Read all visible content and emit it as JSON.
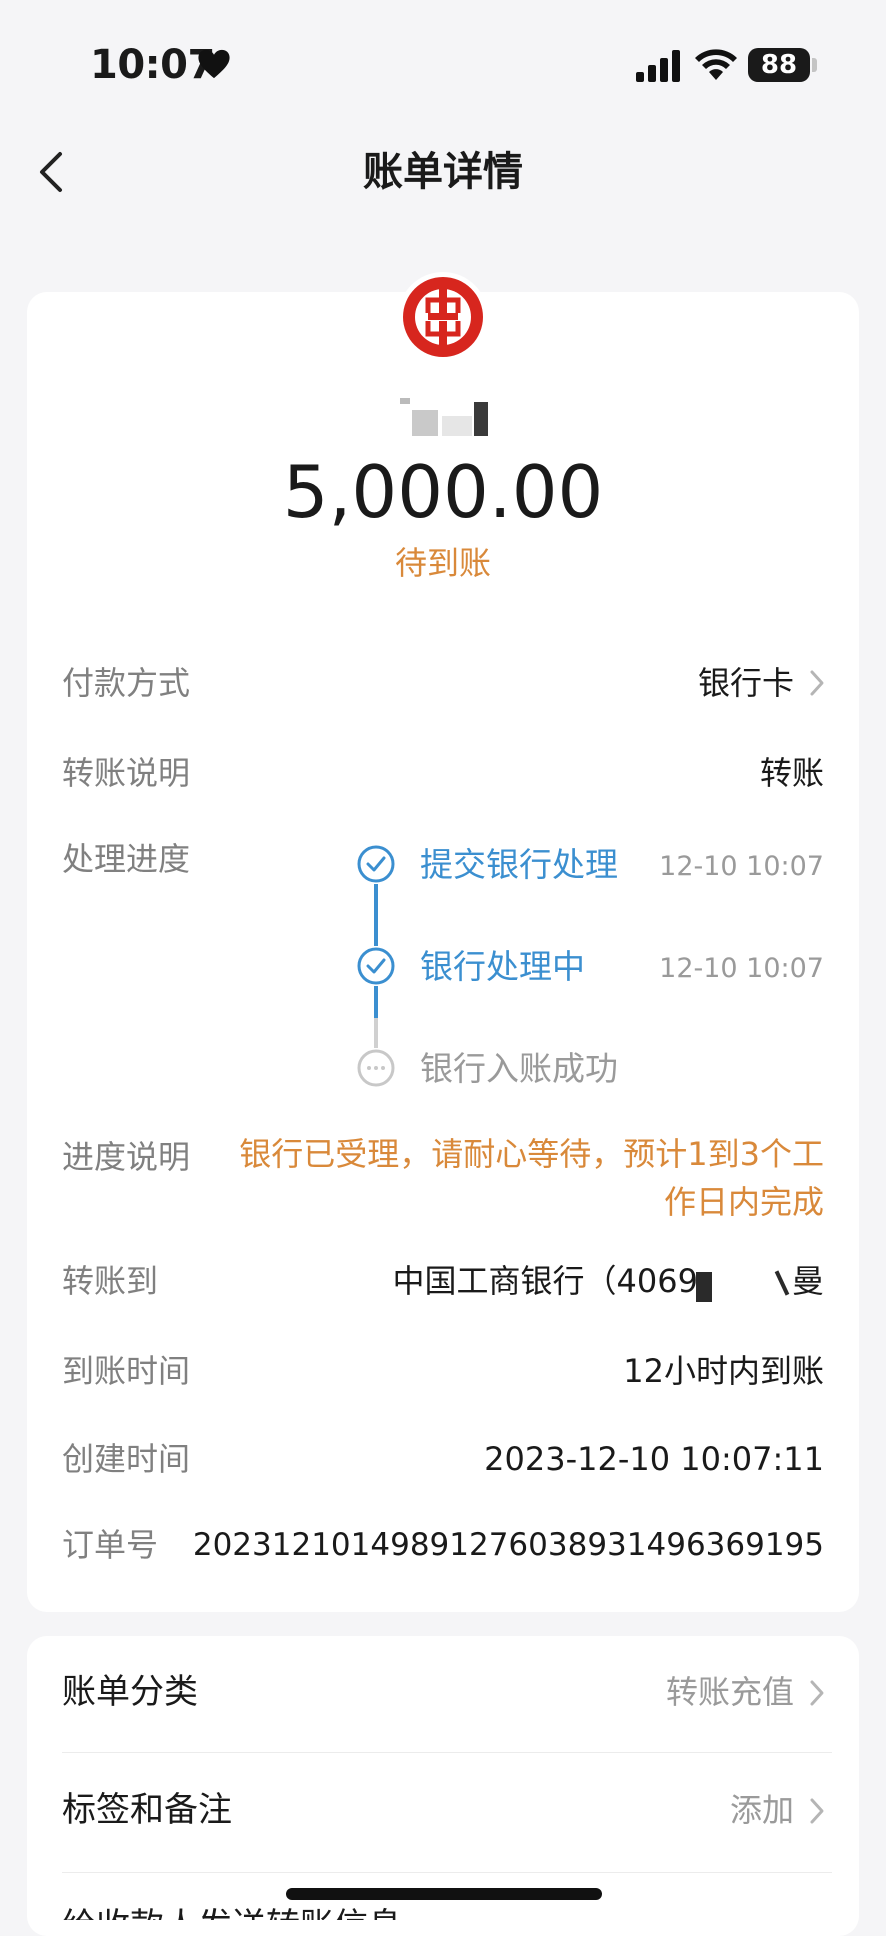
{
  "status_bar": {
    "time": "10:07",
    "battery": "88"
  },
  "nav": {
    "title": "账单详情"
  },
  "bill": {
    "amount": "5,000.00",
    "status": "待到账",
    "status_color": "#d9893a"
  },
  "rows": {
    "payment_method": {
      "label": "付款方式",
      "value": "银行卡"
    },
    "transfer_note": {
      "label": "转账说明",
      "value": "转账"
    },
    "progress": {
      "label": "处理进度"
    },
    "progress_desc": {
      "label": "进度说明",
      "value": "银行已受理，请耐心等待，预计1到3个工作日内完成"
    },
    "transfer_to": {
      "label": "转账到",
      "value": "中国工商银行（4069",
      "value_suffix": "曼"
    },
    "arrival_time": {
      "label": "到账时间",
      "value": "12小时内到账"
    },
    "created_time": {
      "label": "创建时间",
      "value": "2023-12-10 10:07:11"
    },
    "order_no": {
      "label": "订单号",
      "value": "20231210149891276038931496369195"
    }
  },
  "timeline": [
    {
      "label": "提交银行处理",
      "time": "12-10 10:07",
      "done": true
    },
    {
      "label": "银行处理中",
      "time": "12-10 10:07",
      "done": true
    },
    {
      "label": "银行入账成功",
      "time": "",
      "done": false
    }
  ],
  "timeline_color": "#3b8fd0",
  "more": {
    "category": {
      "label": "账单分类",
      "value": "转账充值"
    },
    "tags": {
      "label": "标签和备注",
      "value": "添加"
    },
    "partial": "给收款人发送转账信息"
  },
  "icons": {
    "back": "chevron-left-icon",
    "logo": "icbc-logo",
    "chevron": "chevron-right-icon"
  }
}
